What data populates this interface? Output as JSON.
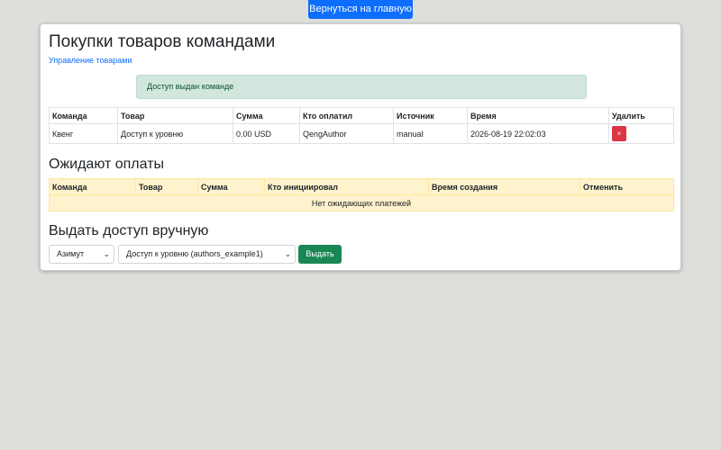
{
  "header": {
    "home_button": "Вернуться на главную"
  },
  "page": {
    "title": "Покупки товаров командами",
    "manage_link": "Управление товарами",
    "alert": "Доступ выдан команде"
  },
  "purchases": {
    "columns": [
      "Команда",
      "Товар",
      "Сумма",
      "Кто оплатил",
      "Источник",
      "Время",
      "Удалить"
    ],
    "rows": [
      {
        "team": "Квенг",
        "product": "Доступ к уровню",
        "amount": "0.00 USD",
        "payer": "QengAuthor",
        "source": "manual",
        "time": "2026-08-19 22:02:03",
        "delete": "×"
      }
    ]
  },
  "pending": {
    "title": "Ожидают оплаты",
    "columns": [
      "Команда",
      "Товар",
      "Сумма",
      "Кто инициировал",
      "Время создания",
      "Отменить"
    ],
    "empty_text": "Нет ожидающих платежей"
  },
  "grant": {
    "title": "Выдать доступ вручную",
    "team_select": "Азимут",
    "product_select": "Доступ к уровню (authors_example1)",
    "submit": "Выдать"
  },
  "colors": {
    "primary": "#0d6efd",
    "success": "#198754",
    "danger": "#dc3545",
    "alert_bg": "#d1e7dd",
    "warning_bg": "#fff3cd",
    "page_bg": "#dedfda"
  }
}
